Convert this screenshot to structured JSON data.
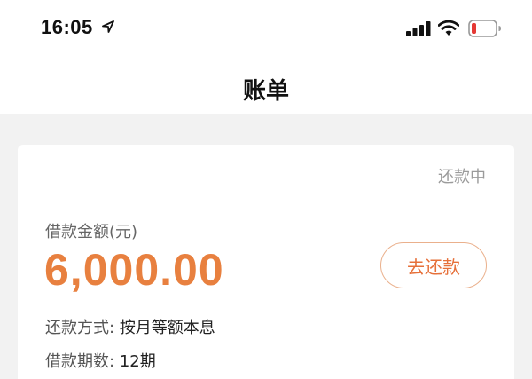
{
  "status_bar": {
    "time": "16:05",
    "icons": [
      "location-arrow-icon",
      "cellular-signal-icon",
      "wifi-icon",
      "battery-low-icon"
    ]
  },
  "nav": {
    "title": "账单"
  },
  "bill": {
    "status": "还款中",
    "amount_label": "借款金额(元)",
    "amount": "6,000.00",
    "repay_button": "去还款",
    "method_label": "还款方式:",
    "method_value": "按月等额本息",
    "term_label": "借款期数:",
    "term_value": "12期"
  },
  "colors": {
    "accent": "#e8803f",
    "button_border": "#eab08c",
    "background": "#f2f2f2",
    "battery_low": "#e53935"
  }
}
